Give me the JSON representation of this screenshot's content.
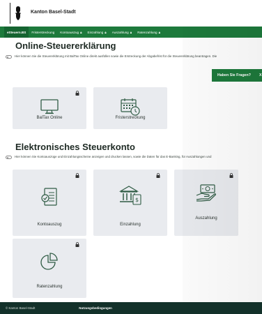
{
  "header": {
    "brand": "Kanton Basel-Stadt"
  },
  "nav": {
    "items": [
      {
        "label": "eSteuern.BS",
        "active": true,
        "locked": false
      },
      {
        "label": "Fristerstreckung",
        "active": false,
        "locked": false
      },
      {
        "label": "Kontoauszug",
        "active": false,
        "locked": true
      },
      {
        "label": "Einzahlung",
        "active": false,
        "locked": true
      },
      {
        "label": "Auszahlung",
        "active": false,
        "locked": true
      },
      {
        "label": "Ratenzahlung",
        "active": false,
        "locked": true
      }
    ]
  },
  "section1": {
    "title": "Online-Steuererklärung",
    "info": "Hier können Sie die Steuererklärung mit BalTax Online direkt ausfüllen sowie die Erstreckung der Abgabefrist für die Steuererklärung beantragen. Die",
    "cards": [
      {
        "label": "BalTax Online",
        "icon": "monitor-icon",
        "locked": true
      },
      {
        "label": "Fristerstreckung",
        "icon": "calendar-clock-icon",
        "locked": false
      }
    ]
  },
  "section2": {
    "title": "Elektronisches Steuerkonto",
    "info": "Hier können Sie Kontoauszüge und Einzahlungsscheine anzeigen und drucken lassen, sowie die Daten für das E-Banking, für Auszahlungen und",
    "cards": [
      {
        "label": "Kontoauszug",
        "icon": "document-check-icon",
        "locked": true
      },
      {
        "label": "Einzahlung",
        "icon": "bank-icon",
        "locked": true
      },
      {
        "label": "Auszahlung",
        "icon": "hand-money-icon",
        "locked": true
      },
      {
        "label": "Ratenzahlung",
        "icon": "pie-chart-icon",
        "locked": true
      }
    ]
  },
  "chat": {
    "label": "Haben Sie Fragen?",
    "close": "X"
  },
  "footer": {
    "copyright": "© Kanton Basel-Stadt",
    "terms": "Nutzungsbedingungen"
  },
  "colors": {
    "brand_green": "#1d7a3c",
    "footer": "#13312a",
    "card": "#e9ebef"
  }
}
